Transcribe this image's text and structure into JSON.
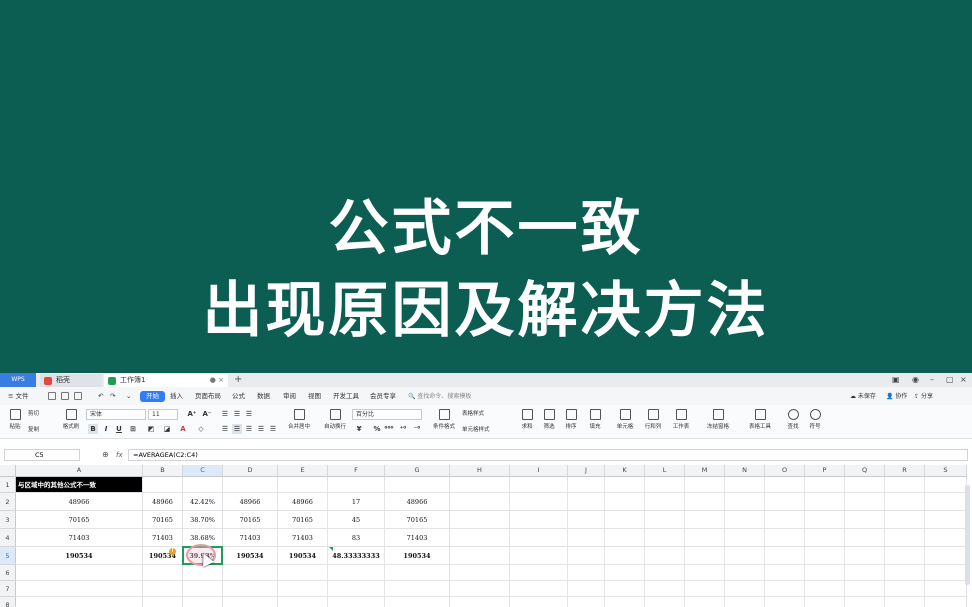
{
  "banner": {
    "line1": "公式不一致",
    "line2": "出现原因及解决方法"
  },
  "titlebar": {
    "wps": "WPS",
    "tabs": [
      {
        "label": "稻壳"
      },
      {
        "label": "工作簿1"
      }
    ]
  },
  "menubar": {
    "file": "文件",
    "items": [
      "开始",
      "插入",
      "页面布局",
      "公式",
      "数据",
      "审阅",
      "视图",
      "开发工具",
      "会员专享"
    ],
    "active": "开始",
    "search": "查找命令、搜索模板",
    "right": [
      "未保存",
      "协作",
      "分享"
    ]
  },
  "ribbon": {
    "clipboard": [
      "粘贴",
      "剪切",
      "复制",
      "格式刷"
    ],
    "font_name": "宋体",
    "font_size": "11",
    "align": [
      "合并居中",
      "自动换行"
    ],
    "number_format": "百分比",
    "tools": [
      "条件格式",
      "表格样式",
      "单元格样式",
      "求和",
      "筛选",
      "排序",
      "填充",
      "单元格",
      "行和列",
      "工作表",
      "冻结窗格",
      "表格工具",
      "查找",
      "符号"
    ]
  },
  "formula": {
    "cell_ref": "C5",
    "fx": "fx",
    "value": "=AVERAGEA(C2:C4)"
  },
  "grid": {
    "columns": [
      "A",
      "B",
      "C",
      "D",
      "E",
      "F",
      "G",
      "H",
      "I",
      "J",
      "K",
      "L",
      "M",
      "N",
      "O",
      "P",
      "Q",
      "R",
      "S"
    ],
    "rows": [
      "1",
      "2",
      "3",
      "4",
      "5",
      "6",
      "7",
      "8"
    ],
    "cells": {
      "r1": [
        "与区域中的其他公式不一致",
        "",
        "",
        "",
        "",
        "",
        ""
      ],
      "r2": [
        "48966",
        "48966",
        "42.42%",
        "48966",
        "48966",
        "17",
        "48966"
      ],
      "r3": [
        "70165",
        "70165",
        "38.70%",
        "70165",
        "70165",
        "45",
        "70165"
      ],
      "r4": [
        "71403",
        "71403",
        "38.68%",
        "71403",
        "71403",
        "83",
        "71403"
      ],
      "r5": [
        "190534",
        "190534",
        "39.93%",
        "190534",
        "190534",
        "48.33333333",
        "190534"
      ]
    },
    "selected_col": "C",
    "selected_row": "5"
  },
  "colors": {
    "banner_bg": "#0b5e51",
    "accent": "#2f7cf6",
    "active_cell": "#1e9c5c"
  }
}
